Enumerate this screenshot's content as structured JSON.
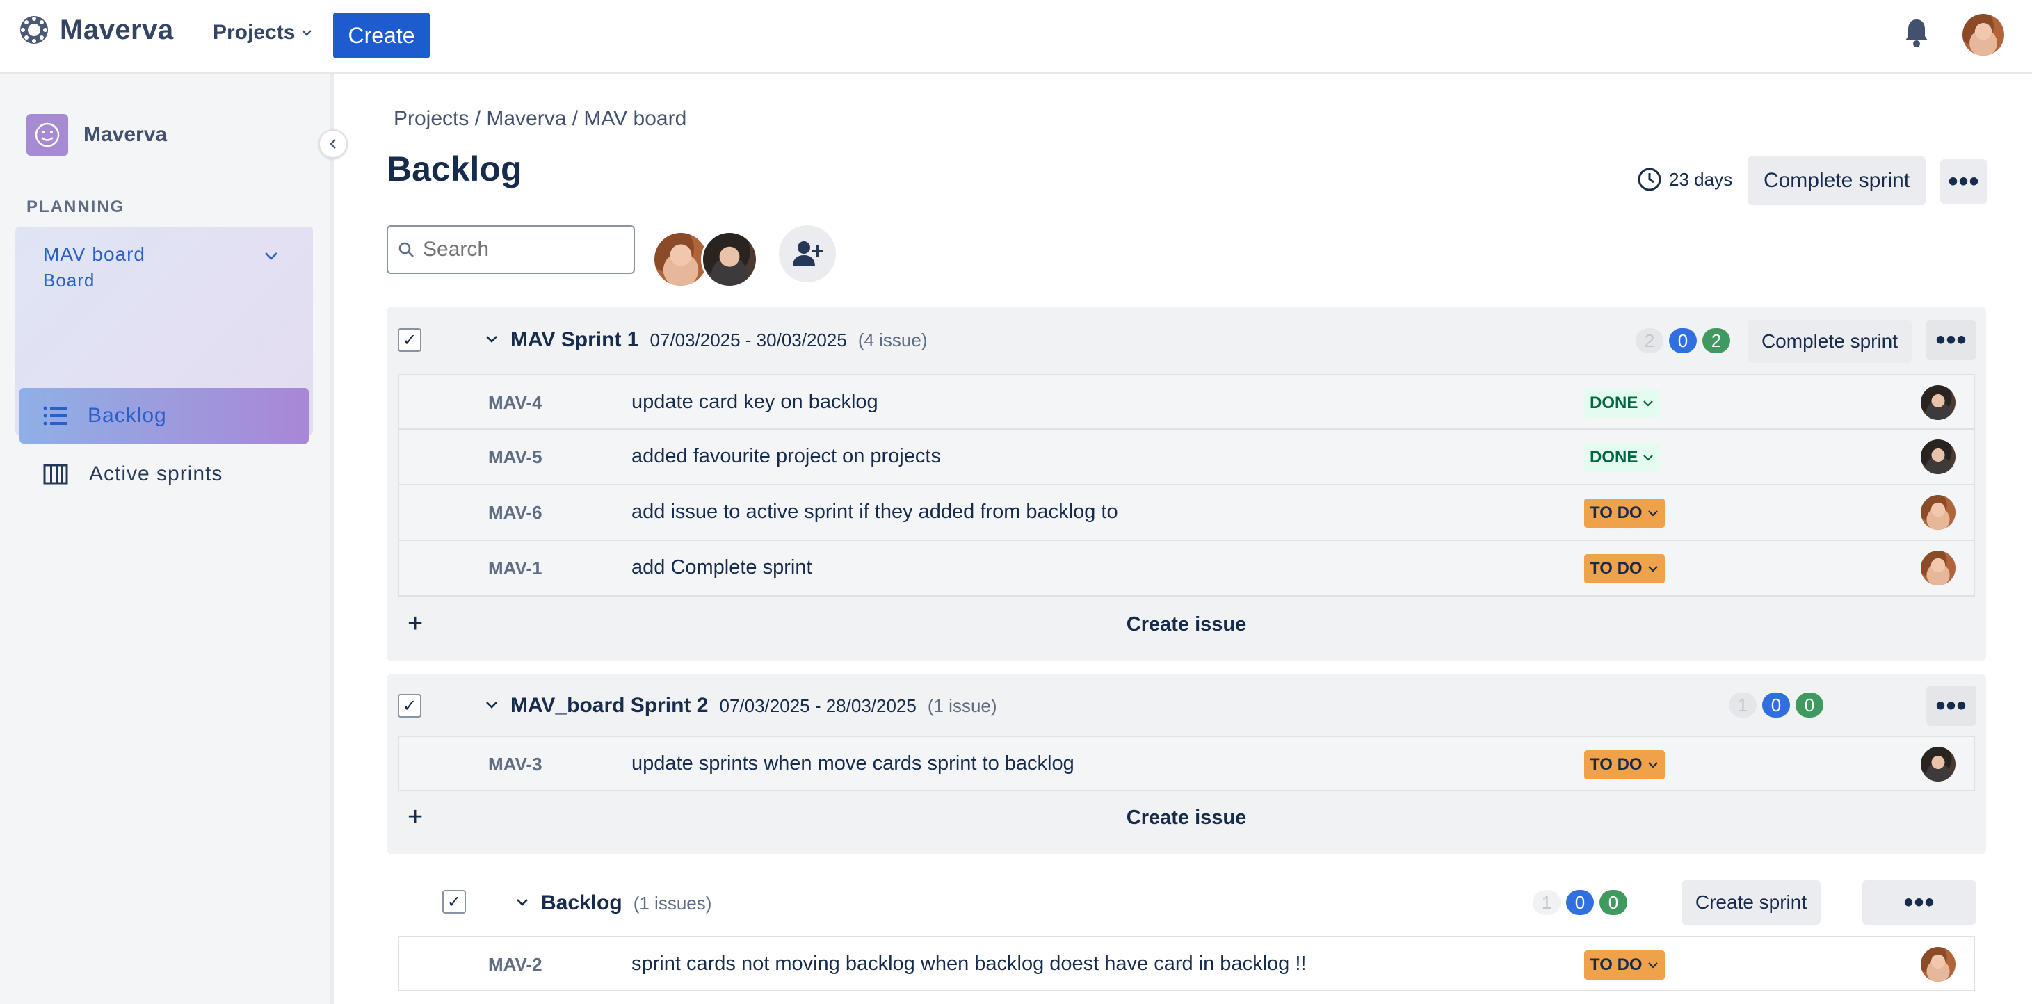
{
  "topbar": {
    "brand": "Maverva",
    "projects_label": "Projects",
    "create_label": "Create"
  },
  "sidebar": {
    "project_name": "Maverva",
    "section_label": "PLANNING",
    "board": {
      "title": "MAV board",
      "subtitle": "Board"
    },
    "items": [
      {
        "label": "Backlog",
        "icon": "list-icon",
        "active": true
      },
      {
        "label": "Active sprints",
        "icon": "columns-icon",
        "active": false
      }
    ]
  },
  "main": {
    "breadcrumb": "Projects / Maverva / MAV board",
    "title": "Backlog",
    "days_remaining": "23 days",
    "complete_sprint_label": "Complete sprint",
    "search_placeholder": "Search",
    "create_issue_label": "Create issue",
    "create_sprint_label": "Create sprint"
  },
  "sprints": [
    {
      "name": "MAV Sprint 1",
      "dates": "07/03/2025 - 30/03/2025",
      "count": "(4 issue)",
      "counts": [
        "2",
        "0",
        "2"
      ],
      "action": "Complete sprint",
      "issues": [
        {
          "key": "MAV-4",
          "summary": "update card key on backlog",
          "status": "DONE"
        },
        {
          "key": "MAV-5",
          "summary": "added favourite project on projects",
          "status": "DONE"
        },
        {
          "key": "MAV-6",
          "summary": "add issue to active sprint if they added from backlog to",
          "status": "TO DO"
        },
        {
          "key": "MAV-1",
          "summary": "add Complete sprint",
          "status": "TO DO"
        }
      ]
    },
    {
      "name": "MAV_board Sprint 2",
      "dates": "07/03/2025 - 28/03/2025",
      "count": "(1 issue)",
      "counts": [
        "1",
        "0",
        "0"
      ],
      "issues": [
        {
          "key": "MAV-3",
          "summary": "update sprints when move cards sprint to backlog",
          "status": "TO DO"
        }
      ]
    }
  ],
  "backlog": {
    "name": "Backlog",
    "count": "(1 issues)",
    "counts": [
      "1",
      "0",
      "0"
    ],
    "issues": [
      {
        "key": "MAV-2",
        "summary": "sprint cards not moving backlog when backlog doest have card in backlog !!",
        "status": "TO DO"
      }
    ]
  },
  "colors": {
    "primary": "#1d5ccf",
    "done_bg": "#e3fcef",
    "done_text": "#006644",
    "todo_bg": "#f0a24a",
    "count_blue": "#2f6fe0",
    "count_green": "#3f9a5f"
  }
}
